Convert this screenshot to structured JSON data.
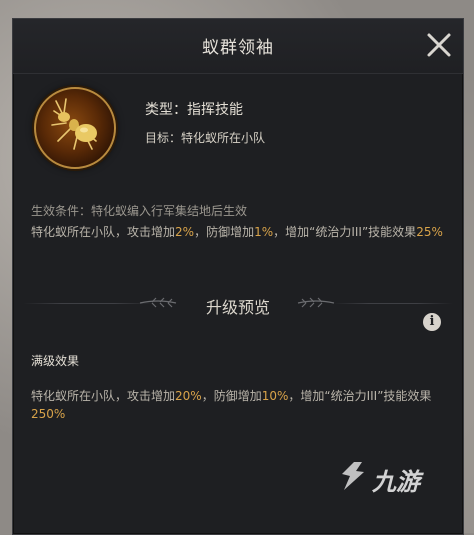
{
  "dialog": {
    "title": "蚁群领袖",
    "skill": {
      "icon": "golden-ant-icon",
      "type_line": "类型：指挥技能",
      "target_line": "目标：特化蚁所在小队"
    },
    "effect_condition": "生效条件：特化蚁编入行军集结地后生效",
    "current_effect": {
      "p1": "特化蚁所在小队，攻击增加",
      "v1": "2%",
      "p2": "，防御增加",
      "v2": "1%",
      "p3": "，增加“统治力III”技能效果",
      "v3": "25%"
    },
    "upgrade_preview_title": "升级预览",
    "max_level_label": "满级效果",
    "max_effect": {
      "p1": "特化蚁所在小队，攻击增加",
      "v1": "20%",
      "p2": "，防御增加",
      "v2": "10%",
      "p3": "，增加“统治力III”技能效果",
      "v3": "250%"
    }
  },
  "watermark": {
    "text": "九游"
  },
  "colors": {
    "panel": "#1e1f22",
    "highlight": "#d8a34a",
    "title": "#e6e2da"
  }
}
